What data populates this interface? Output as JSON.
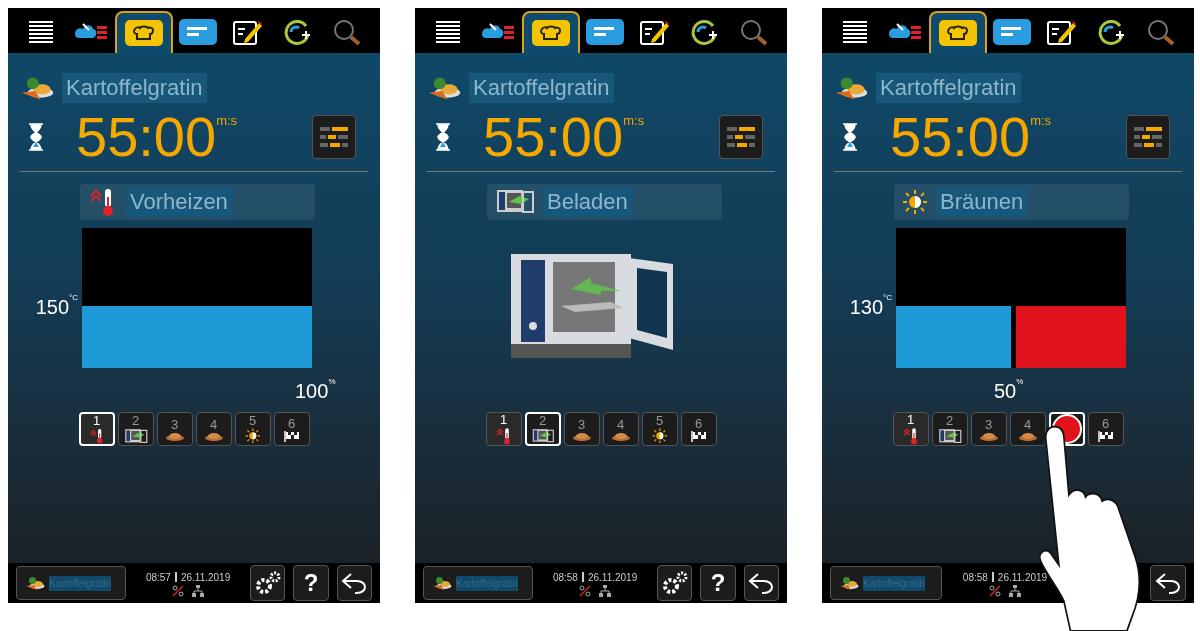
{
  "screens": [
    {
      "tabs": [
        {
          "kind": "menu",
          "selected": false
        },
        {
          "kind": "steam",
          "selected": false
        },
        {
          "kind": "chef",
          "selected": true
        },
        {
          "kind": "program",
          "selected": false
        },
        {
          "kind": "edit",
          "selected": false
        },
        {
          "kind": "add",
          "selected": false
        },
        {
          "kind": "search",
          "selected": false
        }
      ],
      "recipe": "Kartoffelgratin",
      "timer": {
        "value": "55:00",
        "unit": "m:s"
      },
      "step_title": {
        "kind": "preheat",
        "label": "Vorheizen"
      },
      "display": {
        "kind": "bar",
        "temperature": {
          "value": "150",
          "unit": "°C"
        },
        "level": 1,
        "percent": {
          "value": "100",
          "unit": "%"
        }
      },
      "steps": [
        {
          "number": "1",
          "kind": "preheat",
          "done": true,
          "selected": true
        },
        {
          "number": "2",
          "kind": "load",
          "done": false,
          "selected": false
        },
        {
          "number": "3",
          "kind": "dish",
          "done": false,
          "selected": false
        },
        {
          "number": "4",
          "kind": "dish",
          "done": false,
          "selected": false
        },
        {
          "number": "5",
          "kind": "brown",
          "done": false,
          "selected": false
        },
        {
          "number": "6",
          "kind": "finish",
          "done": false,
          "selected": false
        }
      ],
      "bottom": {
        "recipe": "Kartoffelgratin",
        "time": "08:57",
        "date": "26.11.2019",
        "buttons": [
          {
            "kind": "settings"
          },
          {
            "kind": "help",
            "label": "?"
          },
          {
            "kind": "back"
          }
        ]
      }
    },
    {
      "tabs": [
        {
          "kind": "menu",
          "selected": false
        },
        {
          "kind": "steam",
          "selected": false
        },
        {
          "kind": "chef",
          "selected": true
        },
        {
          "kind": "program",
          "selected": false
        },
        {
          "kind": "edit",
          "selected": false
        },
        {
          "kind": "add",
          "selected": false
        },
        {
          "kind": "search",
          "selected": false
        }
      ],
      "recipe": "Kartoffelgratin",
      "timer": {
        "value": "55:00",
        "unit": "m:s"
      },
      "step_title": {
        "kind": "load",
        "label": "Beladen"
      },
      "display": {
        "kind": "oven"
      },
      "steps": [
        {
          "number": "1",
          "kind": "preheat",
          "done": true,
          "selected": false
        },
        {
          "number": "2",
          "kind": "load",
          "done": false,
          "selected": true
        },
        {
          "number": "3",
          "kind": "dish",
          "done": false,
          "selected": false
        },
        {
          "number": "4",
          "kind": "dish",
          "done": false,
          "selected": false
        },
        {
          "number": "5",
          "kind": "brown",
          "done": false,
          "selected": false
        },
        {
          "number": "6",
          "kind": "finish",
          "done": false,
          "selected": false
        }
      ],
      "bottom": {
        "recipe": "Kartoffelgratin",
        "time": "08:58",
        "date": "26.11.2019",
        "buttons": [
          {
            "kind": "settings"
          },
          {
            "kind": "help",
            "label": "?"
          },
          {
            "kind": "back"
          }
        ]
      }
    },
    {
      "tabs": [
        {
          "kind": "menu",
          "selected": false
        },
        {
          "kind": "steam",
          "selected": false
        },
        {
          "kind": "chef",
          "selected": true
        },
        {
          "kind": "program",
          "selected": false
        },
        {
          "kind": "edit",
          "selected": false
        },
        {
          "kind": "add",
          "selected": false
        },
        {
          "kind": "search",
          "selected": false
        }
      ],
      "recipe": "Kartoffelgratin",
      "timer": {
        "value": "55:00",
        "unit": "m:s"
      },
      "step_title": {
        "kind": "brown",
        "label": "Bräunen"
      },
      "display": {
        "kind": "split",
        "temperature": {
          "value": "130",
          "unit": "°C"
        },
        "level": 0.5,
        "percent": {
          "value": "50",
          "unit": "%"
        }
      },
      "steps": [
        {
          "number": "1",
          "kind": "preheat",
          "done": true,
          "selected": false
        },
        {
          "number": "2",
          "kind": "load",
          "done": false,
          "selected": false
        },
        {
          "number": "3",
          "kind": "dish",
          "done": false,
          "selected": false
        },
        {
          "number": "4",
          "kind": "dish",
          "done": false,
          "selected": false
        },
        {
          "kind": "touch",
          "done": false,
          "selected": true
        },
        {
          "number": "6",
          "kind": "finish",
          "done": false,
          "selected": false
        }
      ],
      "bottom": {
        "recipe": "Kartoffelgratin",
        "time": "08:58",
        "date": "26.11.2019",
        "buttons": [
          {
            "kind": "back"
          }
        ]
      },
      "hand": true
    }
  ]
}
